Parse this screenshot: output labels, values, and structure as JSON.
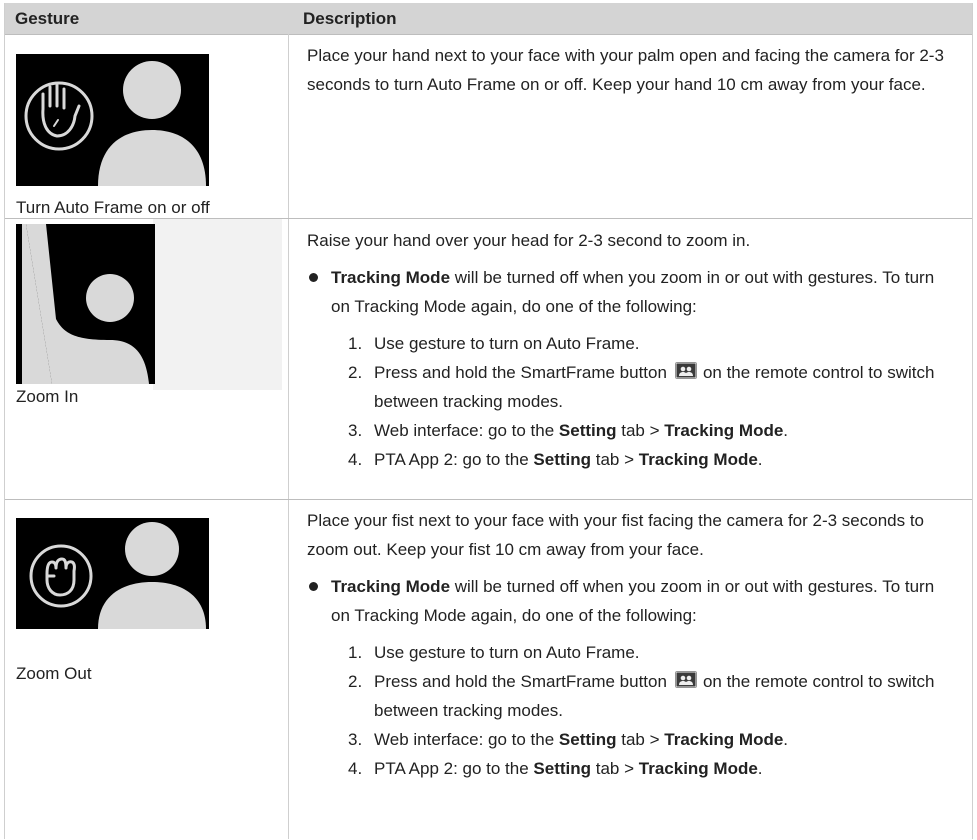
{
  "header": {
    "col_gesture": "Gesture",
    "col_description": "Description"
  },
  "rows": [
    {
      "icon": "open-palm-person",
      "caption": "Turn Auto Frame on or off",
      "description": "Place your hand next to your face with your palm open and facing the camera for 2-3 seconds to turn Auto Frame on or off. Keep your hand 10 cm away from your face."
    },
    {
      "icon": "raised-hand-person",
      "caption": "Zoom In",
      "description": "Raise your hand over your head for 2-3 second to zoom in.",
      "bullet": {
        "bold": "Tracking Mode",
        "text": " will be turned off when you zoom in or out with gestures. To turn on Tracking Mode again, do one of the following:"
      },
      "steps": [
        {
          "num": "1.",
          "text": "Use gesture to turn on Auto Frame."
        },
        {
          "num": "2.",
          "pre": "Press and hold the SmartFrame button",
          "post": "on the remote control to switch between tracking modes.",
          "icon": "smartframe-icon"
        },
        {
          "num": "3.",
          "pre": "Web interface: go to the ",
          "bold1": "Setting",
          "mid": " tab > ",
          "bold2": "Tracking Mode",
          "post": "."
        },
        {
          "num": "4.",
          "pre": "PTA App 2: go to the ",
          "bold1": "Setting",
          "mid": " tab > ",
          "bold2": "Tracking Mode",
          "post": "."
        }
      ]
    },
    {
      "icon": "fist-person",
      "caption": "Zoom Out",
      "description": "Place your fist next to your face with your fist facing the camera for 2-3 seconds to zoom out. Keep your fist 10 cm away from your face.",
      "bullet": {
        "bold": "Tracking Mode",
        "text": " will be turned off when you zoom in or out with gestures. To turn on Tracking Mode again, do one of the following:"
      },
      "steps": [
        {
          "num": "1.",
          "text": "Use gesture to turn on Auto Frame."
        },
        {
          "num": "2.",
          "pre": "Press and hold the SmartFrame button",
          "post": "on the remote control to switch between tracking modes.",
          "icon": "smartframe-icon"
        },
        {
          "num": "3.",
          "pre": "Web interface: go to the ",
          "bold1": "Setting",
          "mid": " tab > ",
          "bold2": "Tracking Mode",
          "post": "."
        },
        {
          "num": "4.",
          "pre": "PTA App 2: go to the ",
          "bold1": "Setting",
          "mid": " tab > ",
          "bold2": "Tracking Mode",
          "post": "."
        }
      ]
    }
  ],
  "colors": {
    "header_bg": "#d4d4d4",
    "icon_bg": "#000000",
    "figure": "#d9d9d9",
    "border": "#bdbdbd"
  }
}
